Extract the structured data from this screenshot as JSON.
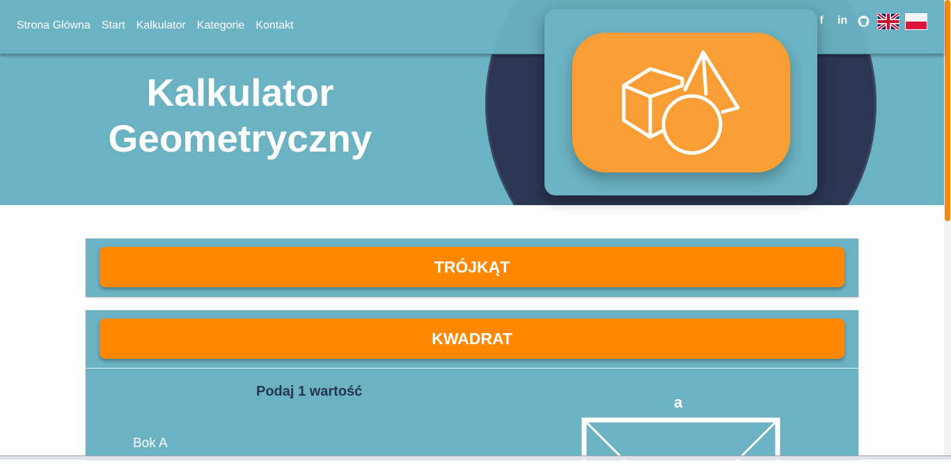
{
  "nav": {
    "links": [
      "Strona Główna",
      "Start",
      "Kalkulator",
      "Kategorie",
      "Kontakt"
    ]
  },
  "social": {
    "icons": [
      "facebook-icon",
      "linkedin-icon",
      "github-icon"
    ],
    "facebook_glyph": "f",
    "linkedin_glyph": "in"
  },
  "languages": [
    "flag-uk",
    "flag-pl"
  ],
  "hero": {
    "title_line1": "Kalkulator",
    "title_line2": "Geometryczny"
  },
  "sections": {
    "triangle_label": "TRÓJKĄT",
    "square_label": "KWADRAT"
  },
  "square_form": {
    "prompt": "Podaj 1 wartość",
    "field_label": "Bok A",
    "diagram_side_label": "a"
  },
  "colors": {
    "hero_bg": "#6bb2c2",
    "dark_circle": "#2b3653",
    "accent_orange": "#ff8800",
    "logo_orange": "#f99e34",
    "prompt_text": "#27344f"
  }
}
